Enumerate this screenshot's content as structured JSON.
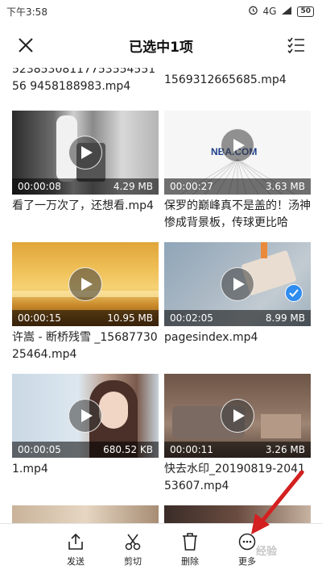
{
  "status_bar": {
    "time": "下午3:58",
    "network": "4G",
    "battery": "50"
  },
  "header": {
    "title": "已选中1项"
  },
  "partial_top": [
    {
      "name": "5238530811775355455156 9458188983.mp4"
    },
    {
      "name": "1569312665685.mp4"
    }
  ],
  "videos": [
    {
      "duration": "00:00:08",
      "size": "4.29 MB",
      "name": "看了一万次了，还想看.mp4",
      "selected": false
    },
    {
      "duration": "00:00:27",
      "size": "3.63 MB",
      "name": "保罗的巅峰真不是盖的！汤神惨成背景板，传球更比哈",
      "selected": false,
      "logo": "NBA.COM"
    },
    {
      "duration": "00:00:15",
      "size": "10.95 MB",
      "name": "许嵩 - 断桥残雪 _1568773025464.mp4",
      "selected": false
    },
    {
      "duration": "00:02:05",
      "size": "8.99 MB",
      "name": "pagesindex.mp4",
      "selected": true
    },
    {
      "duration": "00:00:05",
      "size": "680.52 KB",
      "name": "1.mp4",
      "selected": false
    },
    {
      "duration": "00:00:11",
      "size": "3.26 MB",
      "name": "快去水印_20190819-204153607.mp4",
      "selected": false
    }
  ],
  "actions": [
    {
      "label": "发送",
      "icon": "share-icon"
    },
    {
      "label": "剪切",
      "icon": "scissors-icon"
    },
    {
      "label": "删除",
      "icon": "trash-icon"
    },
    {
      "label": "更多",
      "icon": "more-icon"
    }
  ],
  "watermark": "经验"
}
